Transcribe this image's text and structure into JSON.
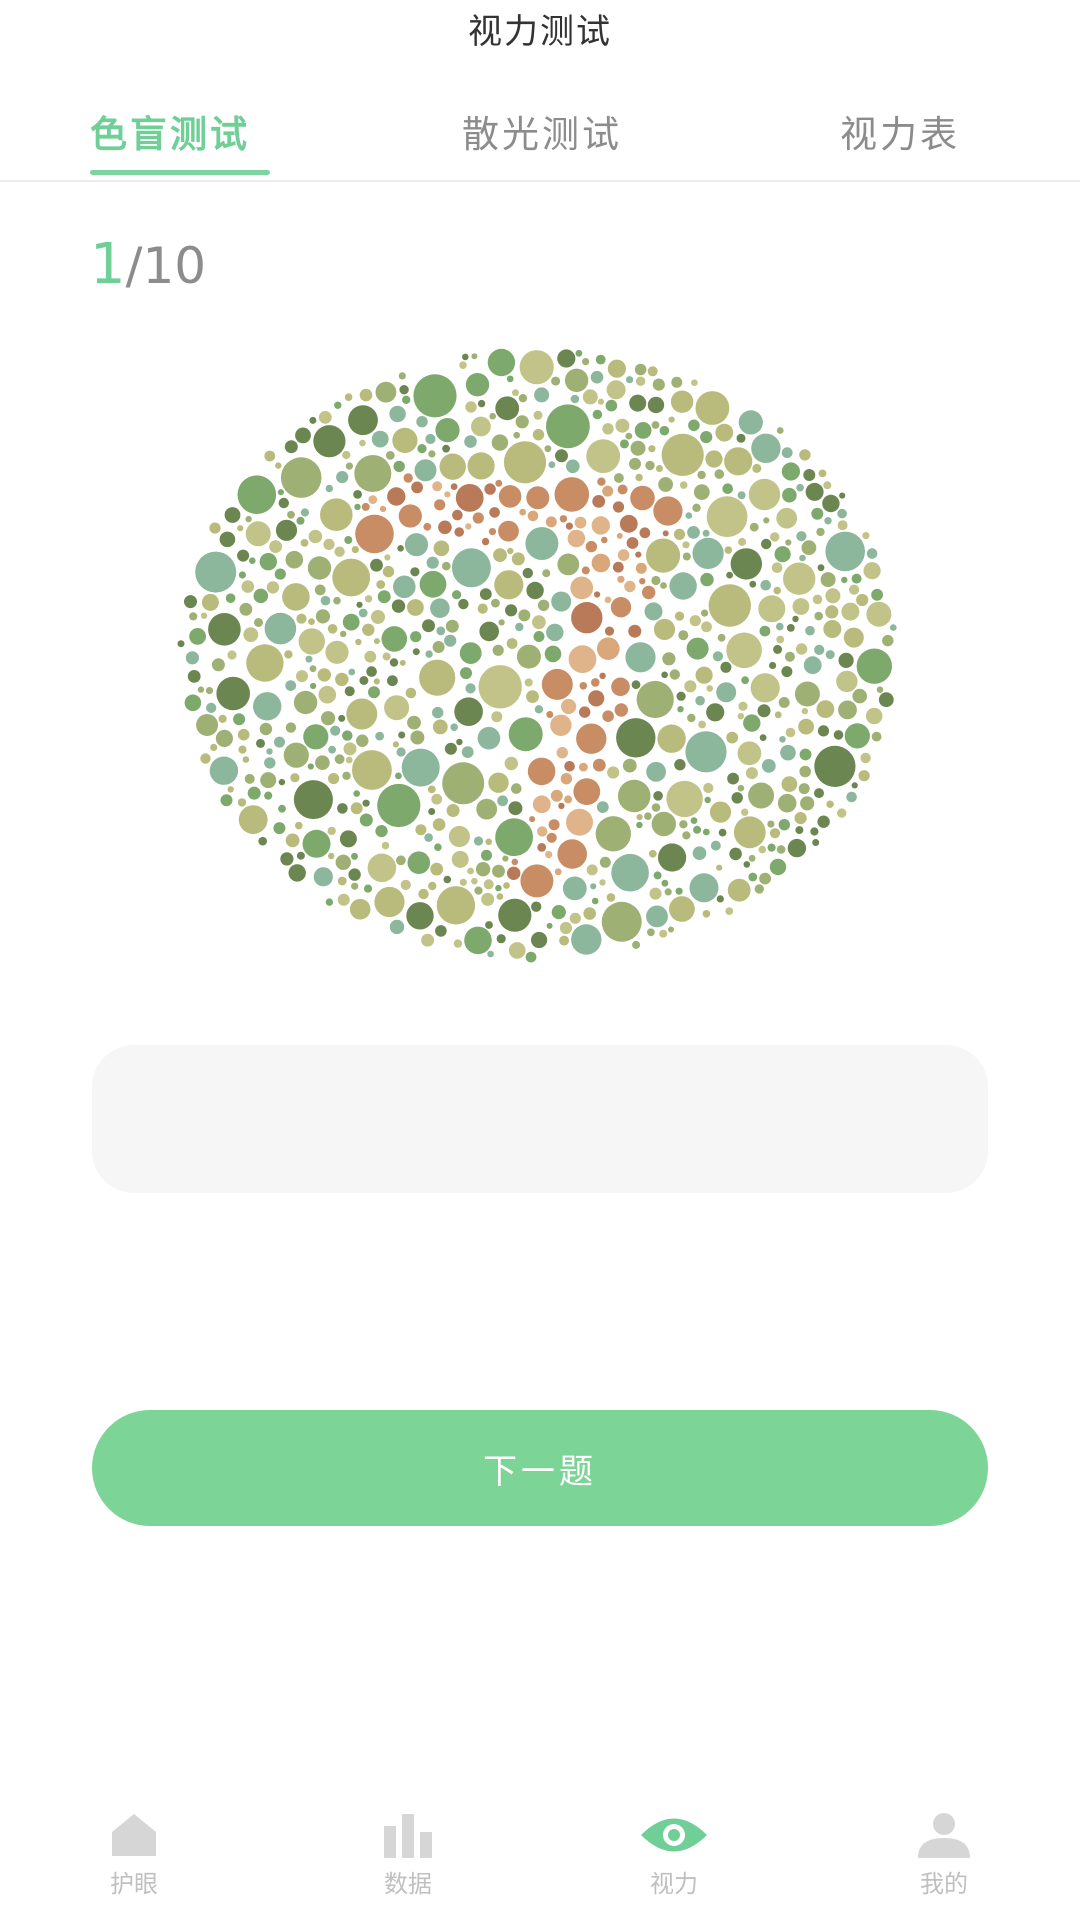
{
  "header": {
    "title": "视力测试"
  },
  "tabs": [
    {
      "label": "色盲测试",
      "active": true
    },
    {
      "label": "散光测试",
      "active": false
    },
    {
      "label": "视力表",
      "active": false
    }
  ],
  "progress": {
    "current": "1",
    "total": "/10"
  },
  "plate": {
    "palette": [
      "#6b8650",
      "#b9bb7c",
      "#8cb79d",
      "#9fb075",
      "#c2c389",
      "#7ea96d"
    ],
    "figure_colors": [
      "#d9a779",
      "#c88d64",
      "#b87a58",
      "#e0b48a"
    ]
  },
  "answer": {
    "placeholder": ""
  },
  "next_button": {
    "label": "下一题"
  },
  "nav": [
    {
      "label": "护眼",
      "icon": "home-icon",
      "active": false
    },
    {
      "label": "数据",
      "icon": "bar-chart-icon",
      "active": false
    },
    {
      "label": "视力",
      "icon": "eye-icon",
      "active": true
    },
    {
      "label": "我的",
      "icon": "user-icon",
      "active": false
    }
  ],
  "colors": {
    "accent": "#6fcf97",
    "button": "#7dd497",
    "inactive": "#8c8c8c"
  }
}
